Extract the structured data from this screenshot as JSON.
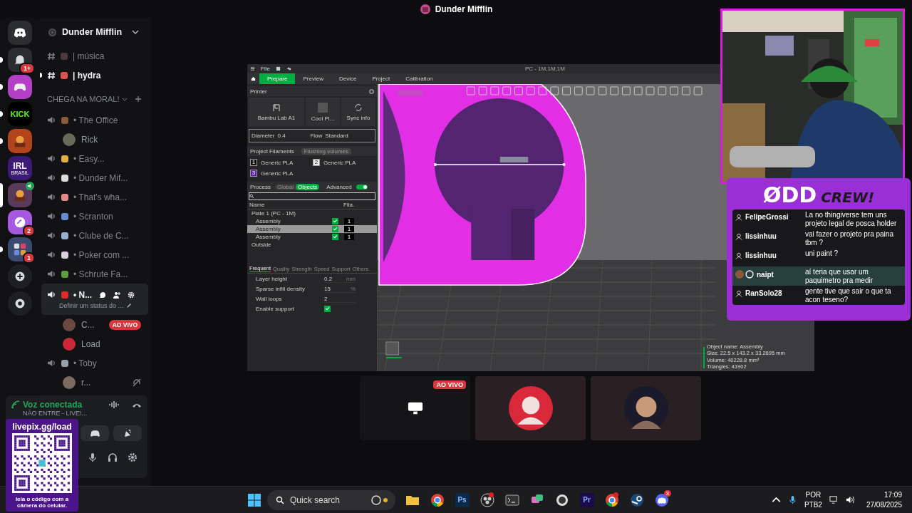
{
  "window": {
    "title": "Dunder Mifflin"
  },
  "servers": [
    {
      "kind": "home",
      "unread": false,
      "selected": false,
      "color": "#2b2d31"
    },
    {
      "kind": "bell",
      "unread": true,
      "selected": false,
      "color": "#2b2d31",
      "badge": "1+"
    },
    {
      "kind": "gamepad",
      "unread": true,
      "selected": false,
      "color": "#b33fc6"
    },
    {
      "kind": "text",
      "unread": true,
      "selected": false,
      "color": "#000000",
      "label": "KICK"
    },
    {
      "kind": "art",
      "unread": true,
      "selected": false,
      "color": "#b2441c"
    },
    {
      "kind": "text",
      "unread": false,
      "selected": false,
      "color": "#3c1a78",
      "label": "IRL",
      "sublabel": "BRASIL"
    },
    {
      "kind": "art",
      "unread": false,
      "selected": true,
      "color": "#5a3a5a",
      "voice": true
    },
    {
      "kind": "logo",
      "unread": false,
      "selected": false,
      "color": "#a659e0",
      "badge": "2"
    },
    {
      "kind": "folder",
      "unread": true,
      "selected": false,
      "color": "#3a4a70",
      "badge": "1"
    },
    {
      "kind": "add",
      "unread": false,
      "selected": false,
      "color": "#1e1f22"
    },
    {
      "kind": "explore",
      "unread": false,
      "selected": false,
      "color": "#1e1f22"
    }
  ],
  "server_name": "Dunder Mifflin",
  "channels": [
    {
      "kind": "text",
      "name": "| música",
      "unread": false,
      "color": "#4a3a40"
    },
    {
      "kind": "text",
      "name": "| hydra",
      "unread": true,
      "color": "#e0524a"
    },
    {
      "kind": "category",
      "name": "CHEGA NA MORAL!"
    },
    {
      "kind": "voice",
      "name": "• The Office",
      "selected": false,
      "color": "#8a5a3a",
      "members": [
        {
          "name": "Rick",
          "color": "#6a6a5a"
        }
      ]
    },
    {
      "kind": "voice",
      "name": "• Easy...",
      "selected": false,
      "color": "#e0b040"
    },
    {
      "kind": "voice",
      "name": "• Dunder Mif...",
      "selected": false,
      "color": "#dddddd"
    },
    {
      "kind": "voice",
      "name": "• That's wha...",
      "selected": false,
      "color": "#e08a8a"
    },
    {
      "kind": "voice",
      "name": "• Scranton",
      "selected": false,
      "color": "#6a8ad0"
    },
    {
      "kind": "voice",
      "name": "• Clube de C...",
      "selected": false,
      "color": "#9ab0d0"
    },
    {
      "kind": "voice",
      "name": "• Poker com ...",
      "selected": false,
      "color": "#d8d0e0"
    },
    {
      "kind": "voice",
      "name": "• Schrute Fa...",
      "selected": false,
      "color": "#5aa040"
    },
    {
      "kind": "voice",
      "name": "• N...",
      "selected": true,
      "color": "#e02a2a",
      "status": "Definir um status do ...",
      "members": [
        {
          "name": "C...",
          "color": "#6a4a40",
          "live": "AO VIVO"
        },
        {
          "name": "Load",
          "color": "#c8283a"
        }
      ]
    },
    {
      "kind": "voice",
      "name": "• Toby",
      "selected": false,
      "color": "#9aa0a8",
      "members": [
        {
          "name": "r...",
          "color": "#7a6a60",
          "deafened": true
        }
      ]
    }
  ],
  "voice_panel": {
    "state": "Voz conectada",
    "channel": "NÃO ENTRE - LIVE!..."
  },
  "app": {
    "menu": "File",
    "title": "PC - 1M,1M,1M",
    "tabs": [
      {
        "label": "Prepare",
        "selected": true
      },
      {
        "label": "Preview",
        "selected": false
      },
      {
        "label": "Device",
        "selected": false
      },
      {
        "label": "Project",
        "selected": false
      },
      {
        "label": "Calibration",
        "selected": false
      }
    ],
    "printer": {
      "heading": "Printer",
      "model": "Bambu Lab A1",
      "plate": "Cool Pl...",
      "sync": "Sync info",
      "diameter_label": "Diameter",
      "diameter": "0.4",
      "flow_label": "Flow",
      "flow": "Standard"
    },
    "filaments": {
      "heading": "Project Filaments",
      "flush": "Flushing volumes",
      "items": [
        {
          "index": "1",
          "name": "Generic PLA",
          "color": "#111111"
        },
        {
          "index": "2",
          "name": "Generic PLA",
          "color": "#eeeeee"
        },
        {
          "index": "3",
          "name": "Generic PLA",
          "color": "#5b1fa8"
        }
      ]
    },
    "process": {
      "heading": "Process",
      "modes": [
        {
          "label": "Global",
          "selected": false
        },
        {
          "label": "Objects",
          "selected": true
        }
      ],
      "advanced_label": "Advanced",
      "advanced": true
    },
    "tree": {
      "columns": [
        "Name",
        "Fila."
      ],
      "rows": [
        {
          "name": "Plate 1 (PC - 1M)",
          "selected": false,
          "children": [
            {
              "name": "Assembly",
              "filament": "1",
              "checked": true,
              "selected": false
            },
            {
              "name": "Assembly",
              "filament": "1",
              "checked": true,
              "selected": true
            },
            {
              "name": "Assembly",
              "filament": "1",
              "checked": true,
              "selected": false
            }
          ]
        },
        {
          "name": "Outside",
          "selected": false
        }
      ]
    },
    "param_tabs": [
      {
        "label": "Frequent",
        "selected": true
      },
      {
        "label": "Quality",
        "selected": false
      },
      {
        "label": "Strength",
        "selected": false
      },
      {
        "label": "Speed",
        "selected": false
      },
      {
        "label": "Support",
        "selected": false
      },
      {
        "label": "Others",
        "selected": false
      }
    ],
    "params": [
      {
        "kind": "number",
        "label": "Layer height",
        "value": "0.2",
        "unit": "mm"
      },
      {
        "kind": "number",
        "label": "Sparse infill density",
        "value": "15",
        "unit": "%"
      },
      {
        "kind": "spin",
        "label": "Wall loops",
        "value": "2"
      },
      {
        "kind": "check",
        "label": "Enable support",
        "checked": true
      }
    ],
    "object_info": [
      "Object name: Assembly",
      "Size: 22.5 x 143.2 x 33.2695 mm",
      "Volume: 40228.8 mm³",
      "Triangles: 41902"
    ]
  },
  "tiles": [
    {
      "kind": "screen",
      "badge": "AO VIVO"
    },
    {
      "kind": "avatar"
    },
    {
      "kind": "camera"
    }
  ],
  "chat": {
    "logo": "ØDD",
    "logo_word": "CREW!",
    "messages": [
      {
        "user": "FelipeGrossi",
        "text": "La no thingiverse tem uns projeto legal de posca holder",
        "highlighted": false
      },
      {
        "user": "lissinhuu",
        "text": "vai fazer o projeto pra paina tbm ?",
        "highlighted": false
      },
      {
        "user": "lissinhuu",
        "text": "uni paint ?",
        "highlighted": false
      },
      {
        "user": "naipt",
        "text": "aí teria que usar um paquimetro pra medir",
        "highlighted": true
      },
      {
        "user": "RanSolo28",
        "text": "gente tive que sair o que ta acon teseno?",
        "highlighted": false
      }
    ]
  },
  "qr": {
    "url": "livepix.gg/load",
    "caption": "leia o código com a câmera do celular."
  },
  "taskbar": {
    "search": "Quick search",
    "apps": [
      {
        "kind": "folder"
      },
      {
        "kind": "chrome"
      },
      {
        "kind": "label",
        "label": "Ps",
        "color": "#0a2a4a"
      },
      {
        "kind": "obs",
        "dot": true
      },
      {
        "kind": "terminal"
      },
      {
        "kind": "chat"
      },
      {
        "kind": "ring"
      },
      {
        "kind": "label",
        "label": "Pr",
        "color": "#1c0a4a"
      },
      {
        "kind": "chrome",
        "dot": true
      },
      {
        "kind": "steam"
      },
      {
        "kind": "discord",
        "badge": "3"
      }
    ],
    "lang": "POR",
    "layout": "PTB2",
    "time": "17:09",
    "date": "27/08/2025"
  }
}
